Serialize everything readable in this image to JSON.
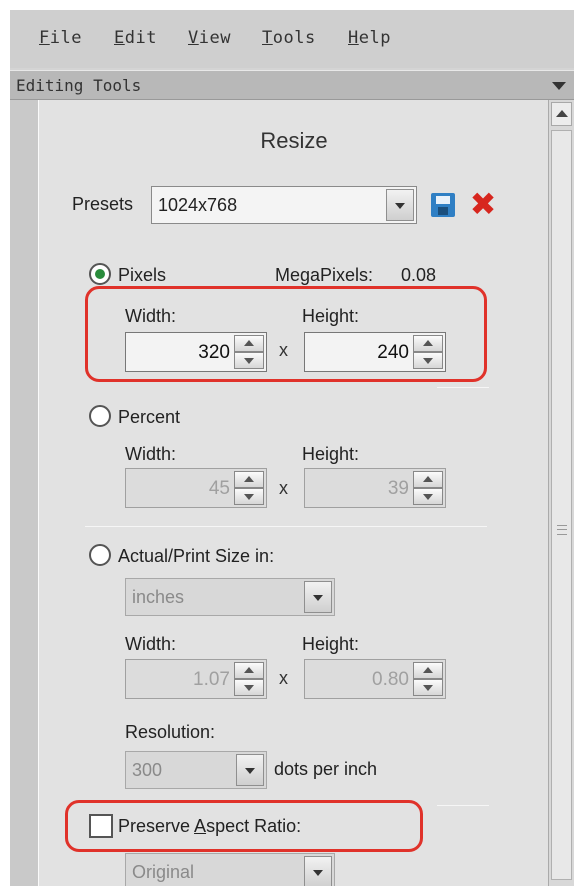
{
  "menu": {
    "items": [
      {
        "accel": "F",
        "rest": "ile"
      },
      {
        "accel": "E",
        "rest": "dit"
      },
      {
        "accel": "V",
        "rest": "iew"
      },
      {
        "accel": "T",
        "rest": "ools"
      },
      {
        "accel": "H",
        "rest": "elp"
      }
    ]
  },
  "panel": {
    "title": "Editing Tools",
    "collapse_icon": "triangle-down-icon"
  },
  "resize": {
    "title": "Resize",
    "presets": {
      "label": "Presets",
      "selected": "1024x768",
      "save_icon": "floppy-disk-icon",
      "delete_icon": "red-x-icon",
      "delete_glyph": "✖"
    },
    "pixels": {
      "label": "Pixels",
      "selected": true,
      "megapixels_label": "MegaPixels:",
      "megapixels_value": "0.08",
      "width_label": "Width:",
      "height_label": "Height:",
      "width_value": "320",
      "height_value": "240",
      "times": "x"
    },
    "percent": {
      "label": "Percent",
      "selected": false,
      "width_label": "Width:",
      "height_label": "Height:",
      "width_value": "45",
      "height_value": "39",
      "times": "x"
    },
    "actual": {
      "label": "Actual/Print Size in:",
      "selected": false,
      "unit": "inches",
      "width_label": "Width:",
      "height_label": "Height:",
      "width_value": "1.07",
      "height_value": "0.80",
      "times": "x",
      "resolution_label": "Resolution:",
      "resolution_value": "300",
      "resolution_unit": "dots per inch"
    },
    "aspect": {
      "label_before": "Preserve ",
      "label_accel": "A",
      "label_after": "spect Ratio:",
      "checked": false,
      "mode": "Original"
    }
  },
  "colors": {
    "highlight": "#e0322a",
    "radio_dot": "#2a8c3c",
    "save_icon": "#2f7fc4",
    "delete_icon": "#d7261e"
  }
}
